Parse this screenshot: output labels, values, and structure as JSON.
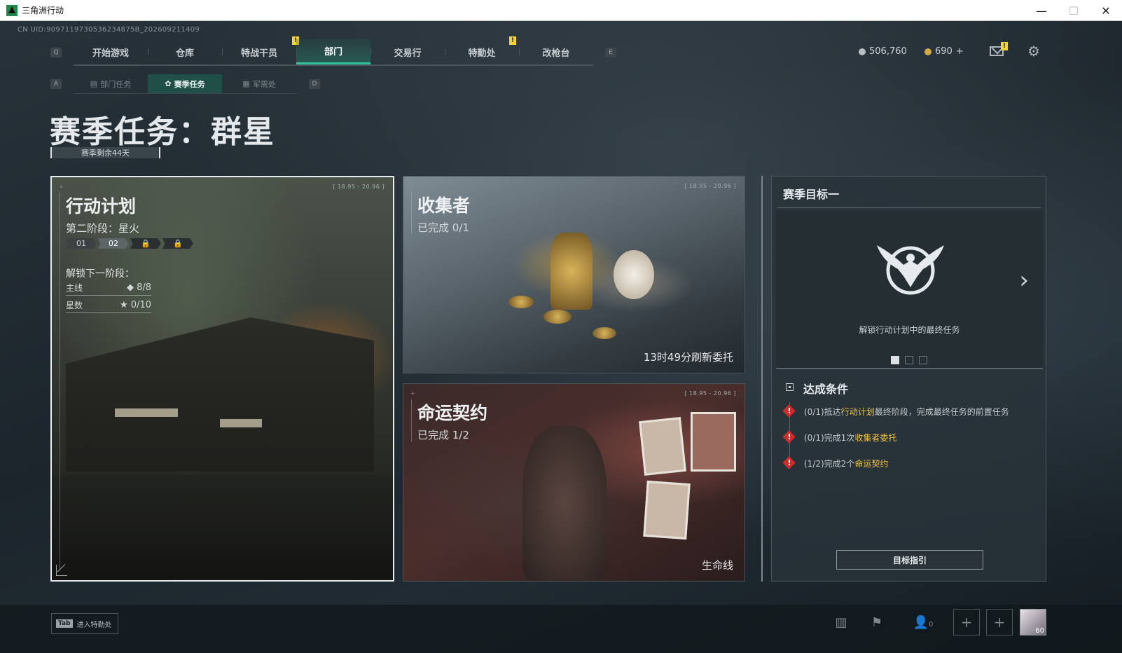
{
  "window": {
    "title": "三角洲行动",
    "controls": [
      "—",
      "☐",
      "✕"
    ]
  },
  "uid_text": "CN UID:9097119730536234875B_202609211409",
  "key_hints": {
    "nav_left": "Q",
    "nav_right": "E",
    "sub_left": "A",
    "sub_right": "D"
  },
  "nav": {
    "tabs": [
      {
        "label": "开始游戏"
      },
      {
        "label": "仓库"
      },
      {
        "label": "特战干员",
        "badge": "!"
      },
      {
        "label": "部门",
        "active": true
      },
      {
        "label": "交易行"
      },
      {
        "label": "特勤处",
        "badge": "!"
      },
      {
        "label": "改枪台"
      }
    ]
  },
  "currency": {
    "silver": "506,760",
    "gold": "690",
    "gold_add": "+"
  },
  "mail_badge": "!",
  "subnav": {
    "tabs": [
      {
        "label": "部门任务",
        "icon": "document-icon"
      },
      {
        "label": "赛季任务",
        "icon": "gear-badge-icon",
        "active": true
      },
      {
        "label": "军需处",
        "icon": "crate-icon"
      }
    ]
  },
  "page": {
    "title": "赛季任务：群星",
    "remaining": "赛季剩余44天"
  },
  "cards": {
    "ops": {
      "title": "行动计划",
      "stage": "第二阶段：星火",
      "chips": [
        "01",
        "02",
        "🔒",
        "🔒"
      ],
      "unlock_title": "解锁下一阶段：",
      "rows": [
        {
          "label": "主线",
          "value": "◆ 8/8"
        },
        {
          "label": "星数",
          "value": "★ 0/10"
        }
      ],
      "corner_tag": "[ 18.95 - 20.96 ]"
    },
    "collect": {
      "title": "收集者",
      "progress": "已完成 0/1",
      "refresh": "13时49分刷新委托",
      "corner_tag": "[ 18.95 - 20.96 ]"
    },
    "fate": {
      "title": "命运契约",
      "progress": "已完成 1/2",
      "tag": "生命线",
      "corner_tag": "[ 18.95 - 20.96 ]"
    }
  },
  "goal": {
    "title": "赛季目标一",
    "emblem_icon": "eagle-emblem-icon",
    "description": "解锁行动计划中的最终任务",
    "pages": 3,
    "current_page": 0,
    "conditions_title": "达成条件",
    "conditions": [
      {
        "pre": "(0/1)抵达",
        "hl": "行动计划",
        "post": "最终阶段，完成最终任务的前置任务"
      },
      {
        "pre": "(0/1)完成1次",
        "hl": "收集者委托",
        "post": ""
      },
      {
        "pre": "(1/2)完成2个",
        "hl": "命运契约",
        "post": ""
      }
    ],
    "guide_button": "目标指引"
  },
  "bottom": {
    "tab_key": "Tab",
    "tab_label": "进入特勤处",
    "friends_count": "0",
    "avatar_level": "60"
  },
  "colors": {
    "accent": "#34c39c",
    "highlight": "#f0c43a",
    "warning": "#d12b2b",
    "badge": "#f3d23a"
  }
}
